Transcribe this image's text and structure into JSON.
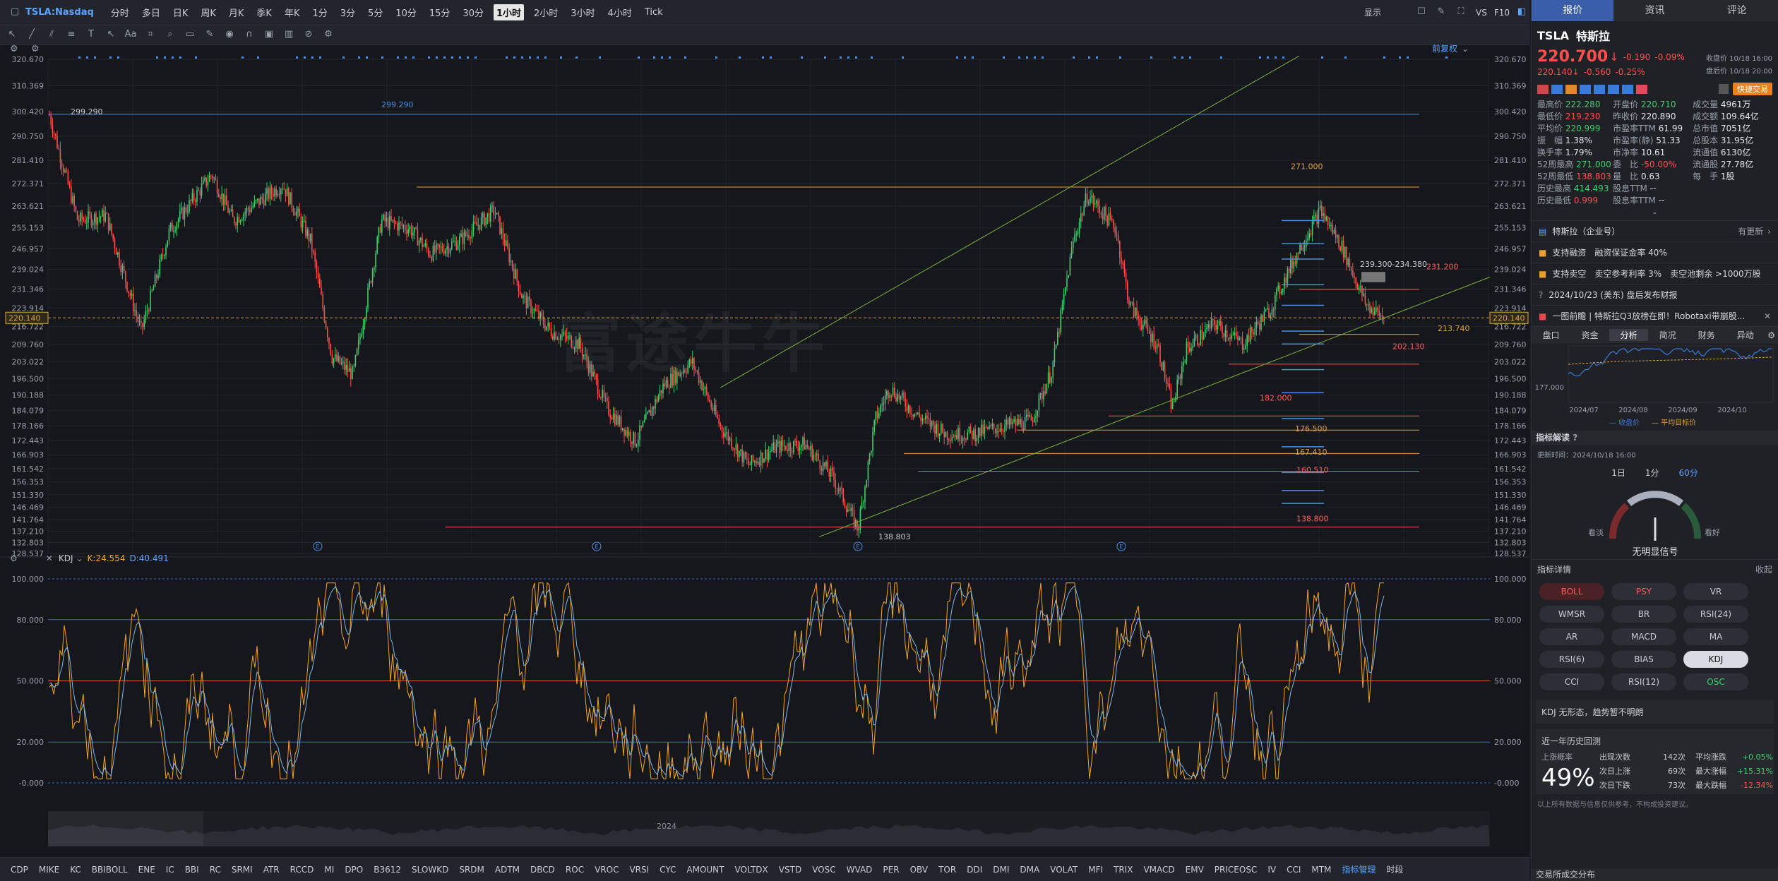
{
  "topbar": {
    "symbol": "TSLA:Nasdaq",
    "timeframes": [
      "分时",
      "多日",
      "日K",
      "周K",
      "月K",
      "季K",
      "年K",
      "1分",
      "3分",
      "5分",
      "10分",
      "15分",
      "30分",
      "1小时",
      "2小时",
      "3小时",
      "4小时",
      "Tick"
    ],
    "active": "1小时",
    "right": [
      "显示",
      "F10",
      "VS"
    ]
  },
  "chart_data": {
    "type": "candlestick",
    "symbol": "TSLA",
    "interval": "1小时",
    "y_ticks": [
      "320.670",
      "310.369",
      "300.420",
      "290.750",
      "281.410",
      "272.371",
      "263.621",
      "255.153",
      "246.957",
      "239.024",
      "231.346",
      "223.914",
      "216.722",
      "209.760",
      "203.022",
      "196.500",
      "190.188",
      "184.079",
      "178.166",
      "172.443",
      "166.903",
      "161.542",
      "156.353",
      "151.330",
      "146.469",
      "141.764",
      "137.210",
      "132.803",
      "128.537"
    ],
    "ylim": [
      128.537,
      320.67
    ],
    "current_price_tag": "220.140",
    "annotations": [
      "299.290",
      "299.290",
      "271.000",
      "239.300-234.380",
      "231.200",
      "213.740",
      "202.130",
      "182.000",
      "176.500",
      "167.410",
      "160.510",
      "138.800",
      "138.803"
    ],
    "watermark": "富途牛牛",
    "adjust_label": "前复权"
  },
  "kdj": {
    "label": "KDJ",
    "k": "K:24.554",
    "d": "D:40.491",
    "y_ticks": [
      "100.000",
      "80.000",
      "50.000",
      "20.000",
      "-0.000"
    ],
    "ylim": [
      0,
      100
    ]
  },
  "navigator": {
    "year": "2024"
  },
  "bottom_indicators": [
    "CDP",
    "MIKE",
    "KC",
    "BBIBOLL",
    "ENE",
    "IC",
    "BBI",
    "RC",
    "SRMI",
    "ATR",
    "RCCD",
    "MI",
    "DPO",
    "B3612",
    "SLOWKD",
    "SRDM",
    "ADTM",
    "DBCD",
    "ROC",
    "VROC",
    "VRSI",
    "CYC",
    "AMOUNT",
    "VOLTDX",
    "VSTD",
    "VOSC",
    "WVAD",
    "PER",
    "OBV",
    "TOR",
    "DDI",
    "DMI",
    "DMA",
    "VOLAT",
    "MFI",
    "TRIX",
    "VMACD",
    "EMV",
    "PRICEOSC",
    "IV",
    "CCI",
    "MTM",
    "指标管理",
    "时段"
  ],
  "rpanel": {
    "tabs": [
      "报价",
      "资讯",
      "评论"
    ],
    "ticker": "TSLA",
    "name": "特斯拉",
    "price": "220.700",
    "change": "-0.190",
    "change_pct": "-0.09%",
    "close_time": "收盘价 10/18 16:00",
    "after_price": "220.140",
    "after_change": "-0.560",
    "after_pct": "-0.25%",
    "after_time": "盘后价 10/18 20:00",
    "fast_trade": "快捷交易",
    "stats": [
      [
        "最高价",
        "222.280",
        "开盘价",
        "220.710",
        "成交量",
        "4961万"
      ],
      [
        "最低价",
        "219.230",
        "昨收价",
        "220.890",
        "成交额",
        "109.64亿"
      ],
      [
        "平均价",
        "220.999",
        "市盈率TTM",
        "61.99",
        "总市值",
        "7051亿"
      ],
      [
        "振　幅",
        "1.38%",
        "市盈率(静)",
        "51.33",
        "总股本",
        "31.95亿"
      ],
      [
        "换手率",
        "1.79%",
        "市净率",
        "10.61",
        "流通值",
        "6130亿"
      ],
      [
        "52周最高",
        "271.000",
        "委　比",
        "-50.00%",
        "流通股",
        "27.78亿"
      ],
      [
        "52周最低",
        "138.803",
        "量　比",
        "0.63",
        "每　手",
        "1股"
      ],
      [
        "历史最高",
        "414.493",
        "股息TTM",
        "--",
        "",
        ""
      ],
      [
        "历史最低",
        "0.999",
        "股息率TTM",
        "--",
        "",
        ""
      ]
    ],
    "company": "特斯拉（企业号）",
    "company_link": "有更新",
    "margin": "支持融资",
    "margin_detail": "融资保证金率 40%",
    "short": "支持卖空",
    "short_detail": "卖空参考利率 3%",
    "short_pool": "卖空池剩余 >1000万股",
    "earnings": "2024/10/23 (美东)  盘后发布财报",
    "news": "一图前瞻 | 特斯拉Q3放榜在即！Robotaxi带崩股...",
    "subtabs": [
      "盘口",
      "资金",
      "分析",
      "简况",
      "财务",
      "异动"
    ],
    "mini_chart": {
      "y_label": "177.000",
      "x": [
        "2024/07",
        "2024/08",
        "2024/09",
        "2024/10"
      ],
      "legend": [
        "收盘价",
        "平均目标价"
      ]
    },
    "indicator_title": "指标解读",
    "update_time": "更新时间：2024/10/18 16:00",
    "periods": [
      "1日",
      "1分",
      "60分"
    ],
    "gauge_left": "看淡",
    "gauge_right": "看好",
    "gauge_label": "无明显信号",
    "detail_title": "指标详情",
    "collapse": "收起",
    "chips": [
      "BOLL",
      "PSY",
      "VR",
      "WMSR",
      "BR",
      "RSI(24)",
      "AR",
      "MACD",
      "MA",
      "RSI(6)",
      "BIAS",
      "KDJ",
      "CCI",
      "RSI(12)",
      "OSC"
    ],
    "kdj_note": "KDJ 无形态，趋势暂不明朗",
    "history_title": "近一年历史回测",
    "up_prob_label": "上涨概率",
    "up_prob": "49%",
    "hist": [
      [
        "出现次数",
        "142次",
        "平均涨跌",
        "+0.05%"
      ],
      [
        "次日上涨",
        "69次",
        "最大涨幅",
        "+15.31%"
      ],
      [
        "次日下跌",
        "73次",
        "最大跌幅",
        "-12.34%"
      ]
    ],
    "disclaimer": "以上所有数据与信息仅供参考，不构成投资建议。",
    "footer": "交易所成交分布"
  }
}
